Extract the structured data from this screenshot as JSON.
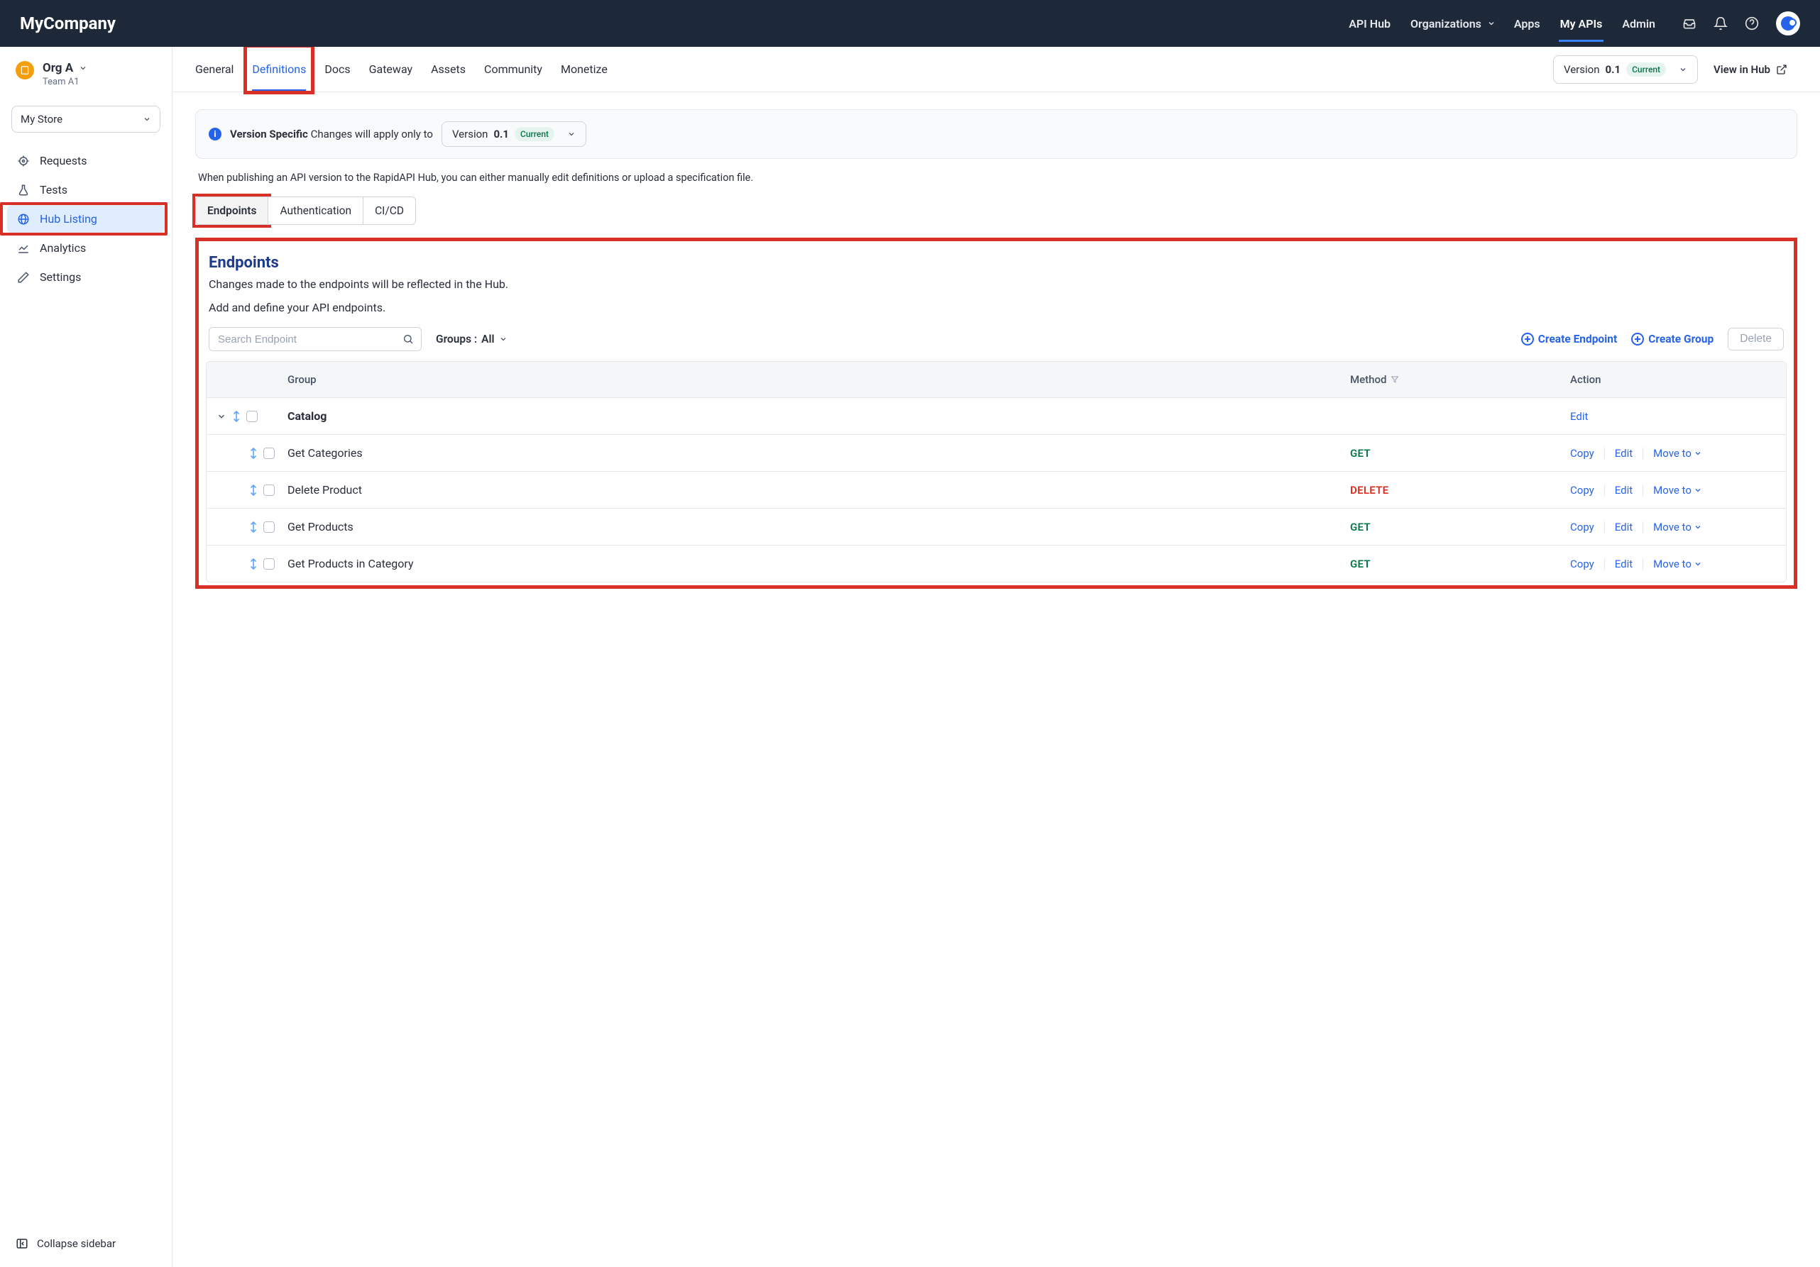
{
  "header": {
    "brand": "MyCompany",
    "nav": {
      "api_hub": "API Hub",
      "organizations": "Organizations",
      "apps": "Apps",
      "my_apis": "My APIs",
      "admin": "Admin"
    }
  },
  "sidebar": {
    "org": {
      "name": "Org A",
      "team": "Team A1"
    },
    "store_select": "My Store",
    "items": {
      "requests": "Requests",
      "tests": "Tests",
      "hub": "Hub Listing",
      "analytics": "Analytics",
      "settings": "Settings"
    },
    "collapse": "Collapse sidebar"
  },
  "main_tabs": {
    "general": "General",
    "definitions": "Definitions",
    "docs": "Docs",
    "gateway": "Gateway",
    "assets": "Assets",
    "community": "Community",
    "monetize": "Monetize"
  },
  "version": {
    "label": "Version",
    "value": "0.1",
    "pill": "Current"
  },
  "view_hub": "View in Hub",
  "banner": {
    "strong": "Version Specific",
    "rest": "Changes will apply only to",
    "version_label": "Version",
    "version_value": "0.1",
    "pill": "Current"
  },
  "desc_line": "When publishing an API version to the RapidAPI Hub, you can either manually edit definitions or upload a specification file.",
  "sub_tabs": {
    "endpoints": "Endpoints",
    "auth": "Authentication",
    "cicd": "CI/CD"
  },
  "panel": {
    "title": "Endpoints",
    "sub1": "Changes made to the endpoints will be reflected in the Hub.",
    "sub2": "Add and define your API endpoints.",
    "search_placeholder": "Search Endpoint",
    "groups_label": "Groups :",
    "groups_value": "All",
    "create_endpoint": "Create Endpoint",
    "create_group": "Create Group",
    "delete": "Delete",
    "columns": {
      "group": "Group",
      "method": "Method",
      "action": "Action"
    },
    "group_name": "Catalog",
    "edit": "Edit",
    "copy": "Copy",
    "moveto": "Move to",
    "rows": [
      {
        "name": "Get Categories",
        "method": "GET"
      },
      {
        "name": "Delete Product",
        "method": "DELETE"
      },
      {
        "name": "Get Products",
        "method": "GET"
      },
      {
        "name": "Get Products in Category",
        "method": "GET"
      }
    ]
  }
}
